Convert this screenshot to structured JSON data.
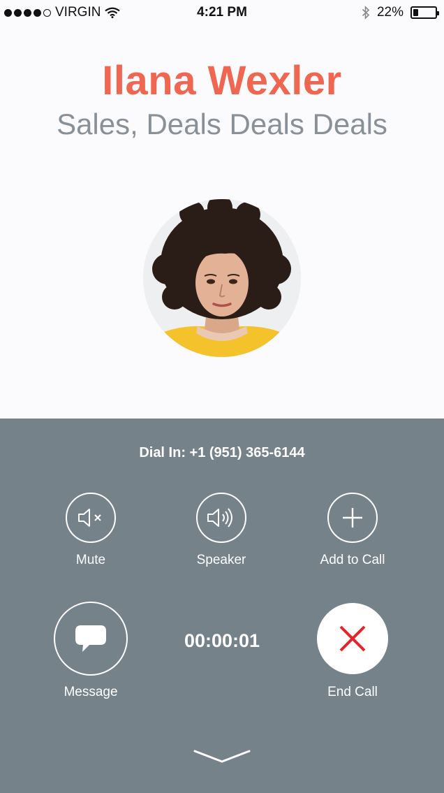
{
  "status_bar": {
    "carrier": "VIRGIN",
    "time": "4:21 PM",
    "battery": "22%",
    "battery_level": 0.22,
    "signal_bars_filled": 4,
    "signal_bars_total": 5
  },
  "contact": {
    "name": "Ilana Wexler",
    "title": "Sales, Deals Deals Deals"
  },
  "call": {
    "dial_in": "Dial In: +1 (951) 365-6144",
    "duration": "00:00:01"
  },
  "controls": {
    "mute": "Mute",
    "speaker": "Speaker",
    "add_to_call": "Add to Call",
    "message": "Message",
    "end_call": "End Call"
  },
  "colors": {
    "accent": "#ef6750",
    "panel": "#76828a",
    "end_call_icon": "#e3242b",
    "subtitle": "#8a9098"
  },
  "icons": [
    "wifi-icon",
    "bluetooth-icon",
    "battery-icon",
    "mute-icon",
    "speaker-icon",
    "plus-icon",
    "message-bubble-icon",
    "close-x-icon",
    "chevron-down-icon"
  ]
}
